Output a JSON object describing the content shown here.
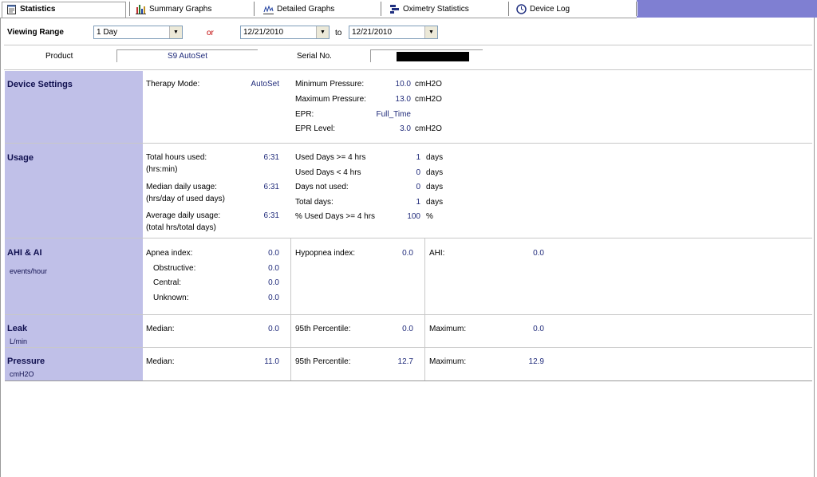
{
  "tabs": [
    {
      "label": "Statistics",
      "icon": "document-icon"
    },
    {
      "label": "Summary Graphs",
      "icon": "bar-chart-icon"
    },
    {
      "label": "Detailed Graphs",
      "icon": "line-graph-icon"
    },
    {
      "label": "Oximetry Statistics",
      "icon": "gantt-icon"
    },
    {
      "label": "Device Log",
      "icon": "clock-icon"
    }
  ],
  "viewing_range": {
    "label": "Viewing Range",
    "range_value": "1 Day",
    "or_label": "or",
    "from_date": "12/21/2010",
    "to_label": "to",
    "to_date": "12/21/2010"
  },
  "product": {
    "label": "Product",
    "value": "S9 AutoSet",
    "serial_label": "Serial No."
  },
  "device_settings": {
    "title": "Device Settings",
    "therapy_mode_label": "Therapy Mode:",
    "therapy_mode_value": "AutoSet",
    "min_pressure_label": "Minimum Pressure:",
    "min_pressure_value": "10.0",
    "max_pressure_label": "Maximum Pressure:",
    "max_pressure_value": "13.0",
    "pressure_unit": "cmH2O",
    "epr_label": "EPR:",
    "epr_value": "Full_Time",
    "epr_level_label": "EPR Level:",
    "epr_level_value": "3.0"
  },
  "usage": {
    "title": "Usage",
    "total_hours_label": "Total hours used:",
    "total_hours_sub": "(hrs:min)",
    "total_hours_value": "6:31",
    "median_label": "Median daily usage:",
    "median_sub": "(hrs/day of used days)",
    "median_value": "6:31",
    "average_label": "Average daily usage:",
    "average_sub": "(total hrs/total days)",
    "average_value": "6:31",
    "days_ge4_label": "Used Days >= 4 hrs",
    "days_ge4_value": "1",
    "days_lt4_label": "Used Days < 4 hrs",
    "days_lt4_value": "0",
    "not_used_label": "Days not used:",
    "not_used_value": "0",
    "total_days_label": "Total days:",
    "total_days_value": "1",
    "pct_label": "% Used Days >= 4 hrs",
    "pct_value": "100",
    "days_unit": "days",
    "pct_unit": "%"
  },
  "ahi": {
    "title": "AHI & AI",
    "subtitle": "events/hour",
    "apnea_label": "Apnea index:",
    "apnea_value": "0.0",
    "obstructive_label": "Obstructive:",
    "obstructive_value": "0.0",
    "central_label": "Central:",
    "central_value": "0.0",
    "unknown_label": "Unknown:",
    "unknown_value": "0.0",
    "hypopnea_label": "Hypopnea index:",
    "hypopnea_value": "0.0",
    "ahi_label": "AHI:",
    "ahi_value": "0.0"
  },
  "leak": {
    "title": "Leak",
    "subtitle": "L/min",
    "median_label": "Median:",
    "median_value": "0.0",
    "p95_label": "95th Percentile:",
    "p95_value": "0.0",
    "max_label": "Maximum:",
    "max_value": "0.0"
  },
  "pressure": {
    "title": "Pressure",
    "subtitle": "cmH2O",
    "median_label": "Median:",
    "median_value": "11.0",
    "p95_label": "95th Percentile:",
    "p95_value": "12.7",
    "max_label": "Maximum:",
    "max_value": "12.9"
  }
}
